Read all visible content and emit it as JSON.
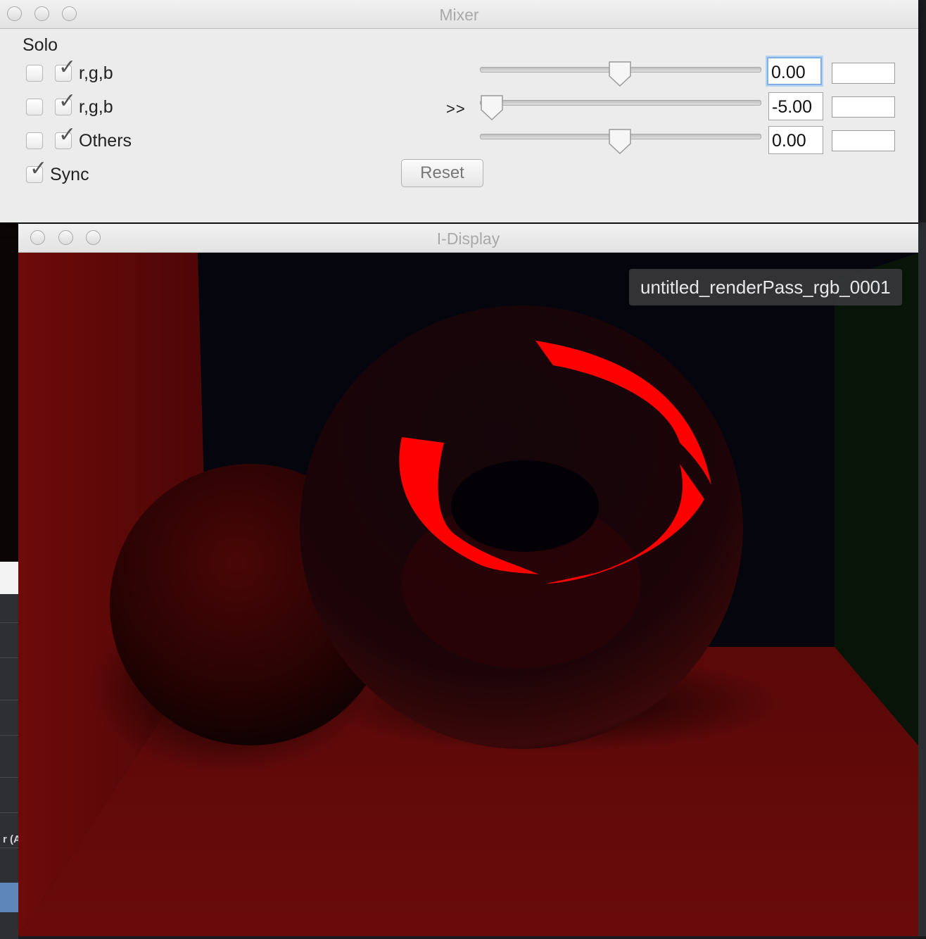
{
  "mixer": {
    "window_title": "Mixer",
    "solo_label": "Solo",
    "rows": [
      {
        "solo_checked": false,
        "enabled_checked": true,
        "label": "r,g,b",
        "value": "0.00",
        "slider_position": 0.5,
        "focused": true,
        "show_arrows": false
      },
      {
        "solo_checked": false,
        "enabled_checked": true,
        "label": "r,g,b",
        "value": "-5.00",
        "slider_position": 0.0,
        "focused": false,
        "show_arrows": true,
        "arrows": ">>"
      },
      {
        "solo_checked": false,
        "enabled_checked": true,
        "label": "Others",
        "value": "0.00",
        "slider_position": 0.5,
        "focused": false,
        "show_arrows": false
      }
    ],
    "sync": {
      "label": "Sync",
      "checked": true
    },
    "reset_label": "Reset"
  },
  "display": {
    "window_title": "I-Display",
    "render_pass_label": "untitled_renderPass_rgb_0001"
  },
  "background": {
    "left_fragment": "r (A"
  },
  "colors": {
    "window_bg": "#ececec",
    "focus_ring": "#7fb0e6",
    "render_red": "#ff0000",
    "render_dark": "#050510"
  },
  "icons": {
    "checkbox_check": "check-icon",
    "traffic_lights": "window-control-icon",
    "slider_knob": "slider-thumb-icon"
  }
}
